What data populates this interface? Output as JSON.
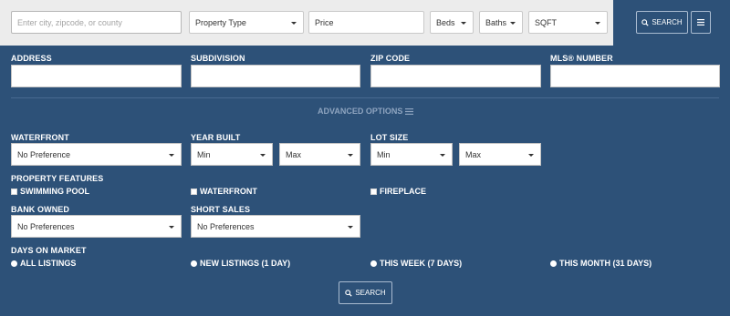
{
  "topbar": {
    "location_placeholder": "Enter city, zipcode, or county",
    "property_type": "Property Type",
    "price": "Price",
    "beds": "Beds",
    "baths": "Baths",
    "sqft": "SQFT",
    "search_label": "SEARCH"
  },
  "fields": {
    "address": "ADDRESS",
    "subdivision": "SUBDIVISION",
    "zip_code": "ZIP CODE",
    "mls_number": "MLS® NUMBER"
  },
  "advanced_options_label": "ADVANCED OPTIONS",
  "waterfront": {
    "label": "WATERFRONT",
    "value": "No Preference"
  },
  "year_built": {
    "label": "YEAR BUILT",
    "min": "Min",
    "max": "Max"
  },
  "lot_size": {
    "label": "LOT SIZE",
    "min": "Min",
    "max": "Max"
  },
  "property_features": {
    "label": "PROPERTY FEATURES",
    "items": [
      "SWIMMING POOL",
      "WATERFRONT",
      "FIREPLACE"
    ]
  },
  "bank_owned": {
    "label": "BANK OWNED",
    "value": "No Preferences"
  },
  "short_sales": {
    "label": "SHORT SALES",
    "value": "No Preferences"
  },
  "days_on_market": {
    "label": "DAYS ON MARKET",
    "options": [
      "ALL LISTINGS",
      "NEW LISTINGS (1 DAY)",
      "THIS WEEK (7 DAYS)",
      "THIS MONTH (31 DAYS)"
    ]
  },
  "bottom_search_label": "SEARCH",
  "colors": {
    "panel": "#2d5178",
    "topbar": "#ececec",
    "muted_text": "#8ea4bf"
  },
  "icons": [
    "search-icon",
    "menu-icon",
    "chevron-down-icon"
  ]
}
